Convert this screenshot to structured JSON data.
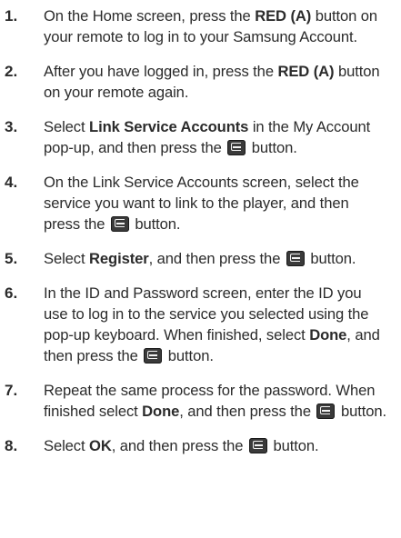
{
  "steps": [
    {
      "number": "1.",
      "parts": [
        {
          "t": "On the Home screen, press the "
        },
        {
          "t": "RED (A)",
          "b": true
        },
        {
          "t": " button on your remote to log in to your Samsung Account."
        }
      ]
    },
    {
      "number": "2.",
      "parts": [
        {
          "t": "After you have logged in, press the "
        },
        {
          "t": "RED (A)",
          "b": true
        },
        {
          "t": " button on your remote again."
        }
      ]
    },
    {
      "number": "3.",
      "parts": [
        {
          "t": "Select "
        },
        {
          "t": "Link Service Accounts",
          "b": true
        },
        {
          "t": " in the My Account pop-up, and then press the "
        },
        {
          "icon": "enter-button-icon"
        },
        {
          "t": " button."
        }
      ]
    },
    {
      "number": "4.",
      "parts": [
        {
          "t": "On the Link Service Accounts screen, select the service you want to link to the player, and then press the "
        },
        {
          "icon": "enter-button-icon"
        },
        {
          "t": " button."
        }
      ]
    },
    {
      "number": "5.",
      "parts": [
        {
          "t": "Select "
        },
        {
          "t": "Register",
          "b": true
        },
        {
          "t": ", and then press the "
        },
        {
          "icon": "enter-button-icon"
        },
        {
          "t": " button."
        }
      ]
    },
    {
      "number": "6.",
      "parts": [
        {
          "t": "In the ID and Password screen, enter the ID you use to log in to the service you selected using the pop-up keyboard. When finished, select "
        },
        {
          "t": "Done",
          "b": true
        },
        {
          "t": ", and then press the "
        },
        {
          "icon": "enter-button-icon"
        },
        {
          "t": " button."
        }
      ]
    },
    {
      "number": "7.",
      "parts": [
        {
          "t": "Repeat the same process for the password. When finished select "
        },
        {
          "t": "Done",
          "b": true
        },
        {
          "t": ", and then press the "
        },
        {
          "icon": "enter-button-icon"
        },
        {
          "t": " button."
        }
      ]
    },
    {
      "number": "8.",
      "parts": [
        {
          "t": "Select "
        },
        {
          "t": "OK",
          "b": true
        },
        {
          "t": ", and then press the "
        },
        {
          "icon": "enter-button-icon"
        },
        {
          "t": " button."
        }
      ]
    }
  ]
}
